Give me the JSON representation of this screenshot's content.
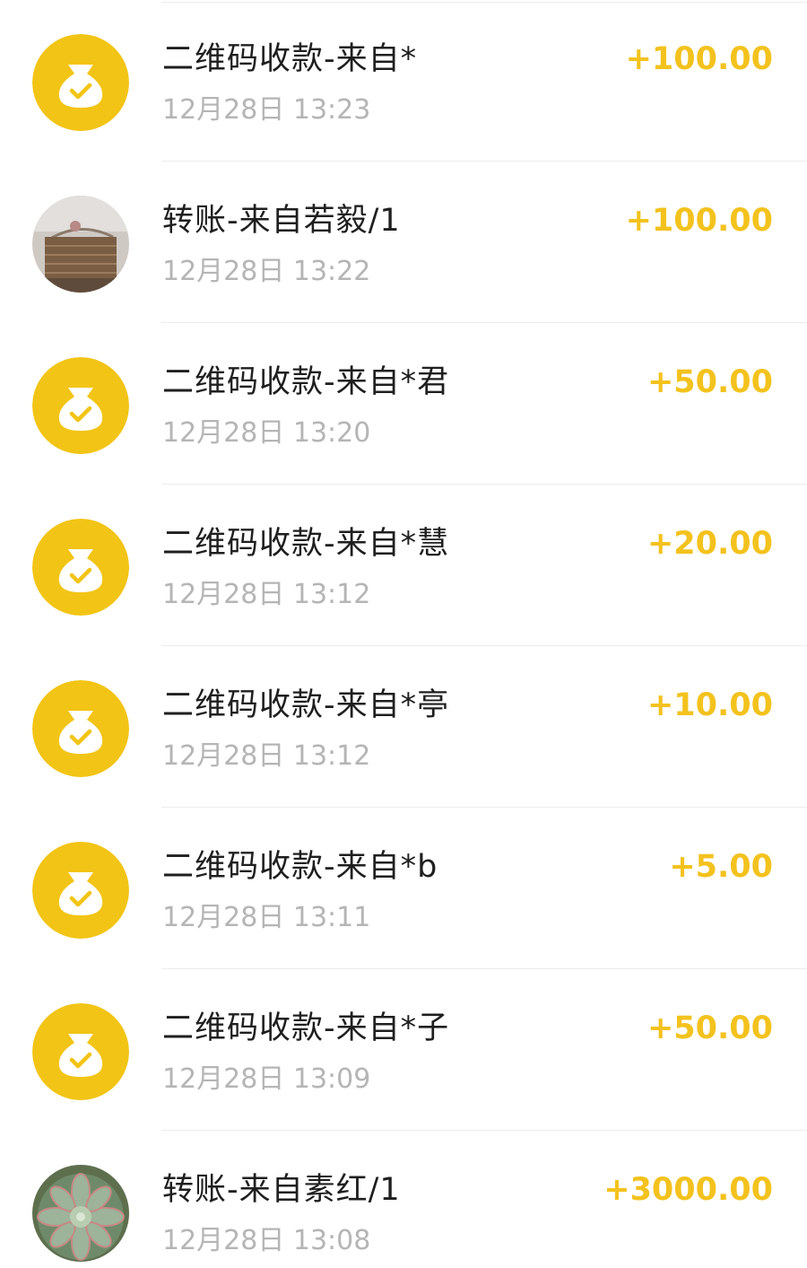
{
  "colors": {
    "accent_gold": "#f3c21d",
    "icon_gold": "#f2c415",
    "title_text": "#1f1f1f",
    "time_text": "#b5b5b5",
    "divider": "#ececec"
  },
  "transactions": [
    {
      "icon": "money-bag-icon",
      "title": "二维码收款-来自*",
      "time": "12月28日 13:23",
      "amount": "+100.00"
    },
    {
      "icon": "basket-photo-avatar",
      "title": "转账-来自若毅/1",
      "time": "12月28日 13:22",
      "amount": "+100.00"
    },
    {
      "icon": "money-bag-icon",
      "title": "二维码收款-来自*君",
      "time": "12月28日 13:20",
      "amount": "+50.00"
    },
    {
      "icon": "money-bag-icon",
      "title": "二维码收款-来自*慧",
      "time": "12月28日 13:12",
      "amount": "+20.00"
    },
    {
      "icon": "money-bag-icon",
      "title": "二维码收款-来自*亭",
      "time": "12月28日 13:12",
      "amount": "+10.00"
    },
    {
      "icon": "money-bag-icon",
      "title": "二维码收款-来自*b",
      "time": "12月28日 13:11",
      "amount": "+5.00"
    },
    {
      "icon": "money-bag-icon",
      "title": "二维码收款-来自*子",
      "time": "12月28日 13:09",
      "amount": "+50.00"
    },
    {
      "icon": "succulent-photo-avatar",
      "title": "转账-来自素红/1",
      "time": "12月28日 13:08",
      "amount": "+3000.00"
    }
  ]
}
